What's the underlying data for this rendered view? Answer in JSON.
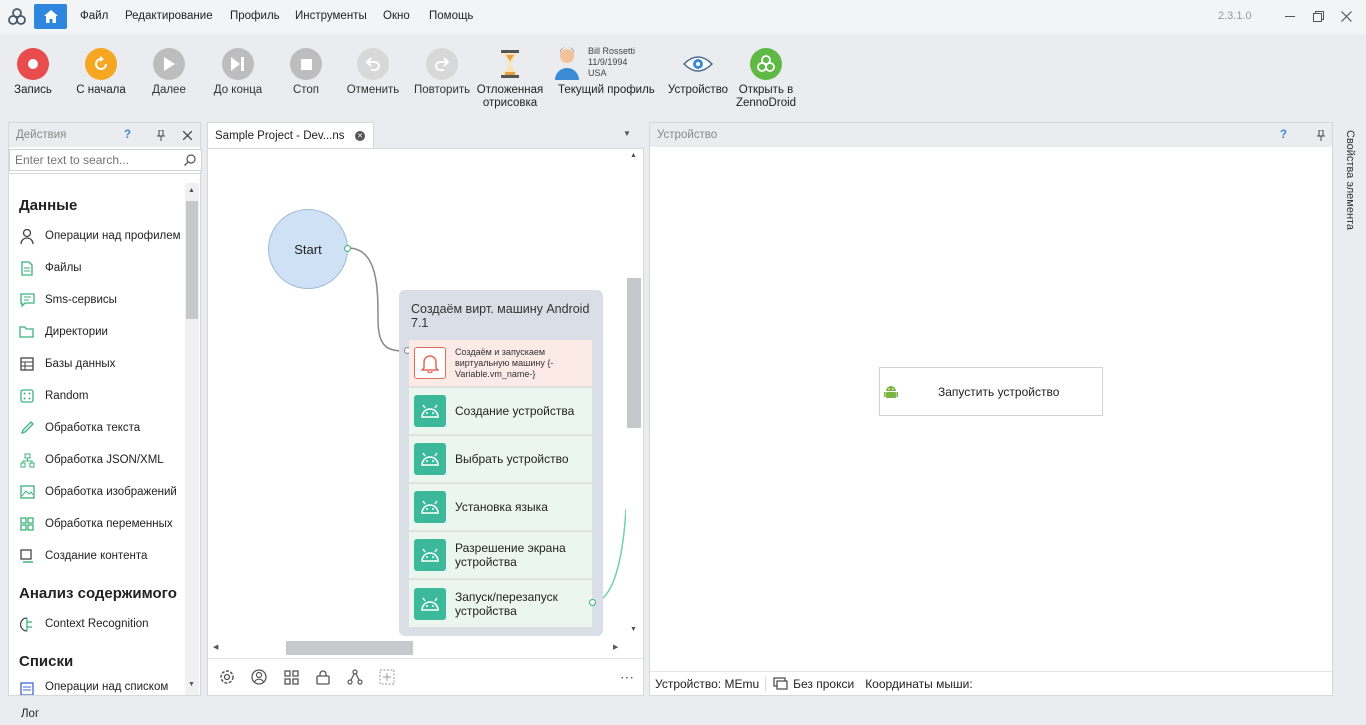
{
  "app": {
    "version": "2.3.1.0"
  },
  "menu": {
    "items": [
      "Файл",
      "Редактирование",
      "Профиль",
      "Инструменты",
      "Окно",
      "Помощь"
    ]
  },
  "toolbar": {
    "record": "Запись",
    "restart": "С начала",
    "next": "Далее",
    "to_end": "До конца",
    "stop": "Стоп",
    "undo": "Отменить",
    "redo": "Повторить",
    "deferred_1": "Отложенная",
    "deferred_2": "отрисовка",
    "profile_name": "Bill Rossetti",
    "profile_date": "11/9/1994",
    "profile_country": "USA",
    "current_profile": "Текущий профиль",
    "device": "Устройство",
    "open_in_1": "Открыть в",
    "open_in_2": "ZennoDroid"
  },
  "actions_panel": {
    "title": "Действия",
    "help": "?",
    "search_placeholder": "Enter text to search...",
    "sections": [
      {
        "title": "Данные",
        "items": [
          "Операции над профилем",
          "Файлы",
          "Sms-сервисы",
          "Директории",
          "Базы данных",
          "Random",
          "Обработка текста",
          "Обработка JSON/XML",
          "Обработка изображений",
          "Обработка переменных",
          "Создание контента"
        ]
      },
      {
        "title": "Анализ содержимого",
        "items": [
          "Context Recognition"
        ]
      },
      {
        "title": "Списки",
        "items": [
          "Операции над списком"
        ]
      }
    ]
  },
  "project_tab": {
    "title": "Sample Project - Dev...ns"
  },
  "canvas": {
    "start_label": "Start",
    "group_title": "Создаём вирт. машину Android 7.1",
    "alert_text": "Создаём и запускаем виртуальную машину {-Variable.vm_name-}",
    "nodes": [
      "Создание устройства",
      "Выбрать устройство",
      "Установка языка",
      "Разрешение экрана устройства",
      "Запуск/перезапуск устройства"
    ]
  },
  "device_panel": {
    "title": "Устройство",
    "help": "?",
    "start_button": "Запустить устройство",
    "status_device": "Устройство: MEmu",
    "status_proxy": "Без прокси",
    "status_coords": "Координаты мыши:"
  },
  "side_tab": {
    "label": "Свойства элемента"
  },
  "bottom": {
    "log": "Лог"
  },
  "colors": {
    "accent": "#2e86de",
    "record": "#e84c4c",
    "restart": "#f5a623",
    "node": "#3bb99a",
    "group_bg": "#d9dee7",
    "start_fill": "#cfe2f5",
    "alert_bg": "#fbeae6",
    "alert_icon": "#e06b5a",
    "zenno": "#5fb944"
  }
}
